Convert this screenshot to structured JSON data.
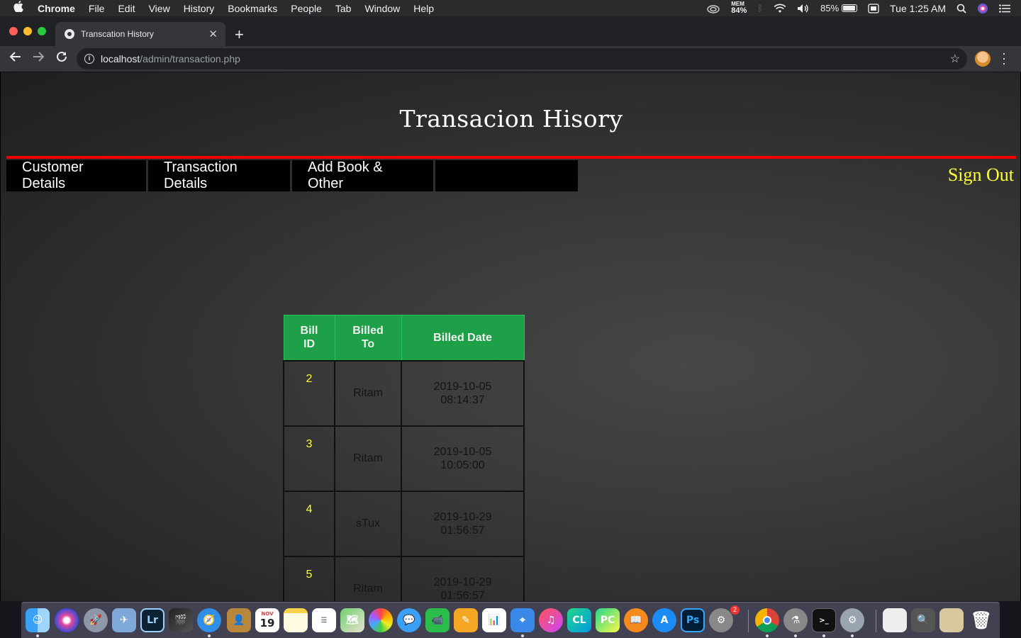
{
  "menubar": {
    "app_name": "Chrome",
    "items": [
      "File",
      "Edit",
      "View",
      "History",
      "Bookmarks",
      "People",
      "Tab",
      "Window",
      "Help"
    ],
    "mem_label": "MEM",
    "mem_value": "84%",
    "battery_percent": "85%",
    "battery_level": 0.85,
    "clock": "Tue 1:25 AM"
  },
  "browser": {
    "tab_title": "Transcation History",
    "url_host": "localhost",
    "url_path": "/admin/transaction.php"
  },
  "page": {
    "title": "Transacion Hisory",
    "nav": [
      "Customer Details",
      "Transaction Details",
      "Add Book & Other"
    ],
    "sign_out": "Sign Out",
    "colors": {
      "rule": "#f20000",
      "header_green": "#1ea048",
      "id_yellow": "#ffff33",
      "sign_out_yellow": "#ffff33"
    }
  },
  "table": {
    "headers": [
      "Bill ID",
      "Billed To",
      "Billed Date"
    ],
    "rows": [
      {
        "id": "2",
        "to": "Ritam",
        "date": "2019-10-05",
        "time": "08:14:37"
      },
      {
        "id": "3",
        "to": "Ritam",
        "date": "2019-10-05",
        "time": "10:05:00"
      },
      {
        "id": "4",
        "to": "sTux",
        "date": "2019-10-29",
        "time": "01:56:57"
      },
      {
        "id": "5",
        "to": "Ritam",
        "date": "2019-10-29",
        "time": "01:56:57"
      }
    ]
  },
  "dock": {
    "calendar_month": "NOV",
    "calendar_day": "19",
    "lightroom": "Lr",
    "clion": "CL",
    "pycharm": "PC",
    "photoshop": "Ps",
    "prefs_badge": "2"
  }
}
